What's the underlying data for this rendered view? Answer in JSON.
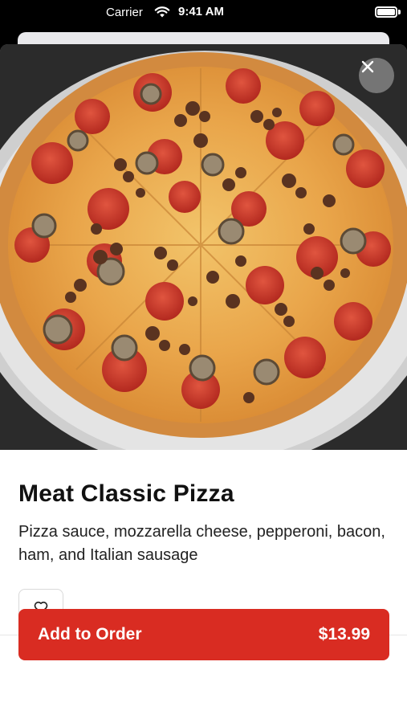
{
  "status_bar": {
    "carrier": "Carrier",
    "time": "9:41 AM"
  },
  "item": {
    "name": "Meat Classic Pizza",
    "description": "Pizza sauce, mozzarella cheese, pepperoni, bacon, ham, and Italian sausage",
    "image_icon": "pizza-photo"
  },
  "actions": {
    "close_icon": "close-icon",
    "favorite_icon": "heart-icon",
    "add_label": "Add to Order",
    "price": "$13.99"
  },
  "colors": {
    "accent": "#d92c22",
    "text": "#111111",
    "close_bg": "#828282"
  }
}
